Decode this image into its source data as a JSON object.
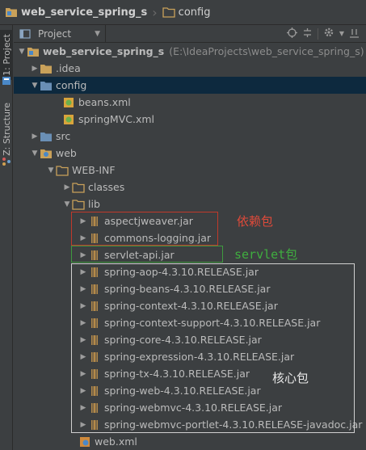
{
  "breadcrumb": {
    "items": [
      {
        "label": "web_service_spring_s",
        "icon": "folder-module-icon"
      },
      {
        "label": "config",
        "icon": "folder-icon"
      }
    ]
  },
  "side_tabs": {
    "project": "1: Project",
    "structure": "Z: Structure"
  },
  "tool_window": {
    "view_label": "Project"
  },
  "tree": {
    "root_label": "web_service_spring_s",
    "root_path": "(E:\\IdeaProjects\\web_service_spring_s)",
    "idea": ".idea",
    "config": "config",
    "beans_xml": "beans.xml",
    "springmvc_xml": "springMVC.xml",
    "src": "src",
    "web": "web",
    "web_inf": "WEB-INF",
    "classes": "classes",
    "lib": "lib",
    "jars": [
      "aspectjweaver.jar",
      "commons-logging.jar",
      "servlet-api.jar",
      "spring-aop-4.3.10.RELEASE.jar",
      "spring-beans-4.3.10.RELEASE.jar",
      "spring-context-4.3.10.RELEASE.jar",
      "spring-context-support-4.3.10.RELEASE.jar",
      "spring-core-4.3.10.RELEASE.jar",
      "spring-expression-4.3.10.RELEASE.jar",
      "spring-tx-4.3.10.RELEASE.jar",
      "spring-web-4.3.10.RELEASE.jar",
      "spring-webmvc-4.3.10.RELEASE.jar",
      "spring-webmvc-portlet-4.3.10.RELEASE-javadoc.jar"
    ],
    "web_xml": "web.xml"
  },
  "annotations": {
    "dependency": "依赖包",
    "servlet": "servlet包",
    "core": "核心包"
  },
  "colors": {
    "background": "#3c3f41",
    "selection": "#0d293e",
    "dependency_box": "#c0392b",
    "servlet_box": "#3f9a3f",
    "core_box": "#d0d0d0",
    "folder": "#c9a15a",
    "config_folder": "#6a8fb5"
  }
}
